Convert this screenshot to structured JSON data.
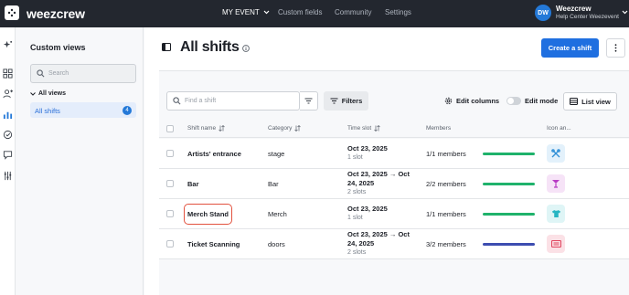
{
  "topbar": {
    "brand": "weezcrew",
    "nav": [
      {
        "label": "MY EVENT"
      },
      {
        "label": "Custom fields"
      },
      {
        "label": "Community"
      },
      {
        "label": "Settings"
      }
    ],
    "account": {
      "initials": "DW",
      "name": "Weezcrew",
      "subtitle": "Help Center Weezevent"
    }
  },
  "rail": {
    "icons": [
      "sparkle-icon",
      "grid-icon",
      "people-icon",
      "chart-icon",
      "check-circle-icon",
      "chat-icon",
      "sliders-icon"
    ]
  },
  "sidebar": {
    "title": "Custom views",
    "search_placeholder": "Search",
    "group_label": "All views",
    "items": [
      {
        "label": "All shifts",
        "count": "4"
      }
    ]
  },
  "main": {
    "title": "All shifts",
    "create_label": "Create a shift",
    "find_placeholder": "Find a shift",
    "filters_label": "Filters",
    "edit_columns_label": "Edit columns",
    "edit_mode_label": "Edit mode",
    "list_view_label": "List view"
  },
  "table": {
    "columns": {
      "name": "Shift name",
      "category": "Category",
      "time": "Time slot",
      "members": "Members",
      "icon": "Icon an..."
    },
    "rows": [
      {
        "name": "Artists' entrance",
        "category": "stage",
        "date1": "Oct 23, 2025",
        "date2": "",
        "slots": "1 slot",
        "members": "1/1 members",
        "progress": 1.0,
        "bar_color": "#1fb26b",
        "icon": "tools-icon",
        "icon_bg": "#e3f1fb",
        "icon_color": "#2f8fd6"
      },
      {
        "name": "Bar",
        "category": "Bar",
        "date1": "Oct 23, 2025 → Oct",
        "date2": "24, 2025",
        "slots": "2 slots",
        "members": "2/2 members",
        "progress": 1.0,
        "bar_color": "#1fb26b",
        "icon": "cocktail-icon",
        "icon_bg": "#f6e3f7",
        "icon_color": "#b83cc4"
      },
      {
        "name": "Merch Stand",
        "category": "Merch",
        "date1": "Oct 23, 2025",
        "date2": "",
        "slots": "1 slot",
        "members": "1/1 members",
        "progress": 1.0,
        "bar_color": "#1fb26b",
        "icon": "tshirt-icon",
        "icon_bg": "#dff5f6",
        "icon_color": "#27b5c2"
      },
      {
        "name": "Ticket Scanning",
        "category": "doors",
        "date1": "Oct 23, 2025 → Oct",
        "date2": "24, 2025",
        "slots": "2 slots",
        "members": "3/2 members",
        "progress": 1.0,
        "bar_color": "#3d4db0",
        "icon": "ticket-icon",
        "icon_bg": "#fbe1e6",
        "icon_color": "#e0455f"
      }
    ]
  }
}
